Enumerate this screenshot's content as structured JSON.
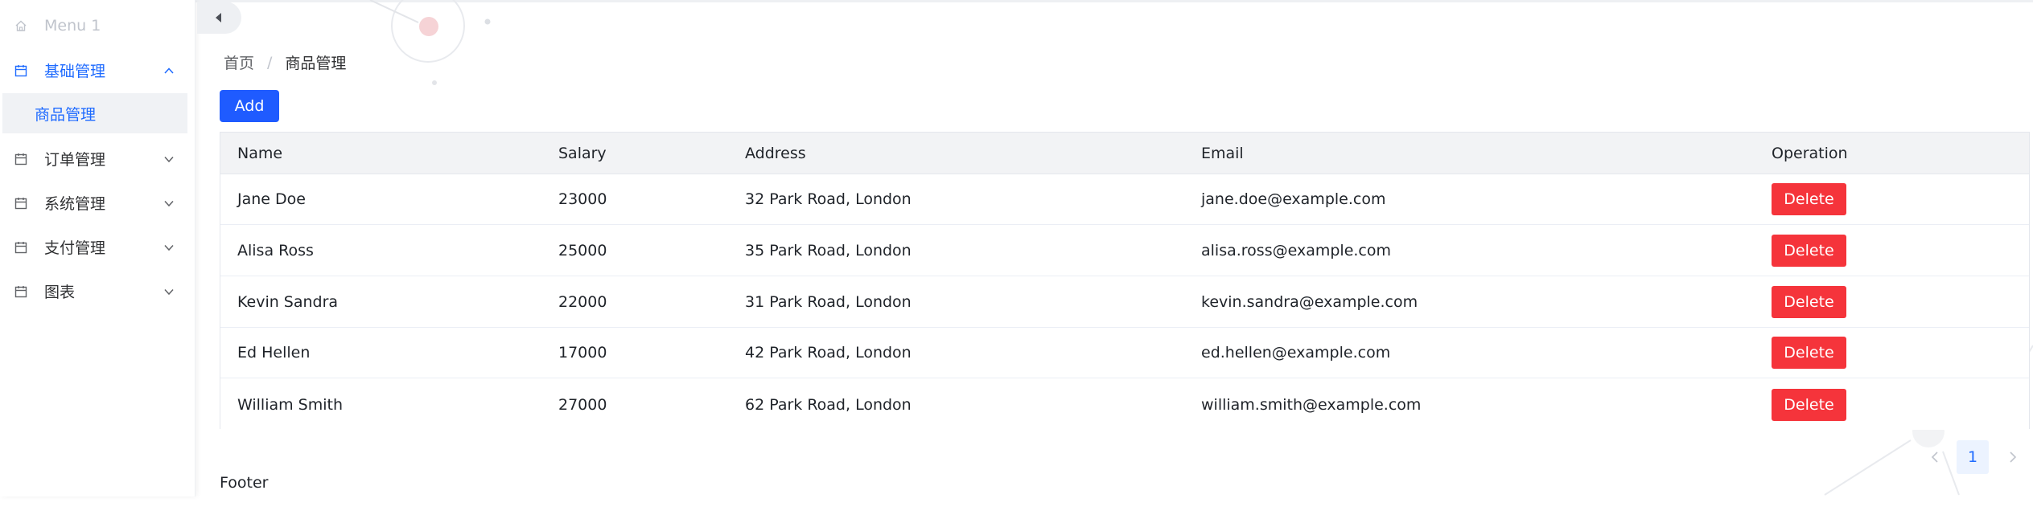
{
  "sidebar": {
    "items": [
      {
        "label": "Menu 1",
        "icon": "home-icon",
        "state": "disabled"
      },
      {
        "label": "基础管理",
        "icon": "calendar-icon",
        "state": "expanded",
        "chevron": "chevron-up-icon",
        "children": [
          {
            "label": "商品管理",
            "selected": true
          }
        ]
      },
      {
        "label": "订单管理",
        "icon": "calendar-icon",
        "chevron": "chevron-down-icon"
      },
      {
        "label": "系统管理",
        "icon": "calendar-icon",
        "chevron": "chevron-down-icon"
      },
      {
        "label": "支付管理",
        "icon": "calendar-icon",
        "chevron": "chevron-down-icon"
      },
      {
        "label": "图表",
        "icon": "calendar-icon",
        "chevron": "chevron-down-icon"
      }
    ],
    "collapse_icon": "caret-left-icon"
  },
  "breadcrumb": {
    "home": "首页",
    "separator": "/",
    "current": "商品管理"
  },
  "toolbar": {
    "add_label": "Add"
  },
  "table": {
    "columns": [
      "Name",
      "Salary",
      "Address",
      "Email",
      "Operation"
    ],
    "rows": [
      {
        "name": "Jane Doe",
        "salary": "23000",
        "address": "32 Park Road, London",
        "email": "jane.doe@example.com",
        "action": "Delete"
      },
      {
        "name": "Alisa Ross",
        "salary": "25000",
        "address": "35 Park Road, London",
        "email": "alisa.ross@example.com",
        "action": "Delete"
      },
      {
        "name": "Kevin Sandra",
        "salary": "22000",
        "address": "31 Park Road, London",
        "email": "kevin.sandra@example.com",
        "action": "Delete"
      },
      {
        "name": "Ed Hellen",
        "salary": "17000",
        "address": "42 Park Road, London",
        "email": "ed.hellen@example.com",
        "action": "Delete"
      },
      {
        "name": "William Smith",
        "salary": "27000",
        "address": "62 Park Road, London",
        "email": "william.smith@example.com",
        "action": "Delete"
      }
    ]
  },
  "pagination": {
    "current_page": "1",
    "prev_icon": "chevron-left-icon",
    "next_icon": "chevron-right-icon"
  },
  "footer": {
    "text": "Footer"
  },
  "colors": {
    "primary": "#1f5bff",
    "active_text": "#1f6bff",
    "danger": "#f5343b",
    "header_bg": "#f2f3f5",
    "selected_bg": "#f0f2f5"
  }
}
